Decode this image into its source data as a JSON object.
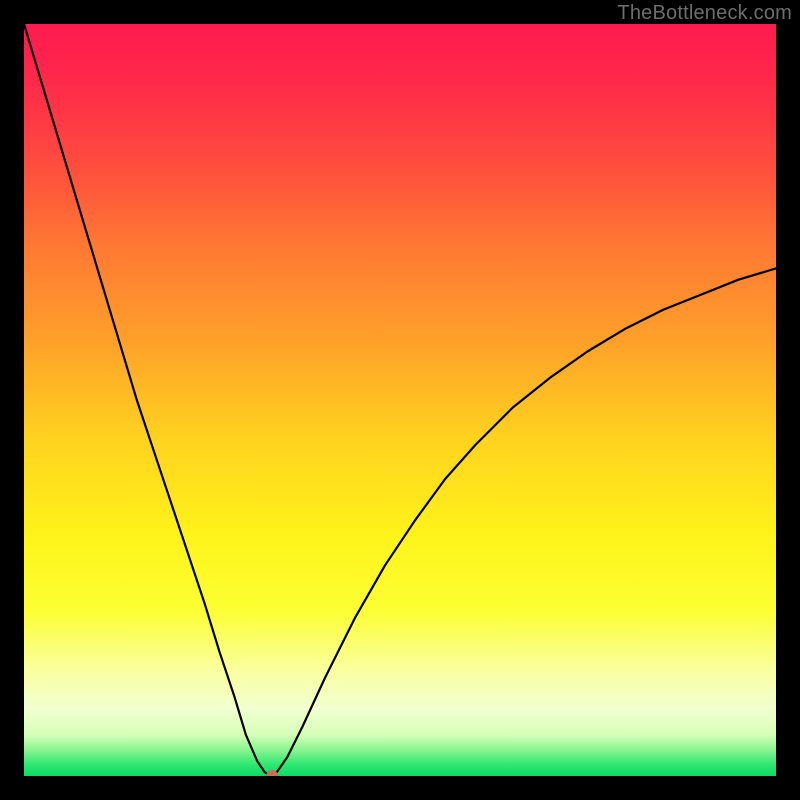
{
  "watermark": "TheBottleneck.com",
  "chart_data": {
    "type": "line",
    "title": "",
    "xlabel": "",
    "ylabel": "",
    "xlim": [
      0,
      100
    ],
    "ylim": [
      0,
      100
    ],
    "curve": {
      "name": "bottleneck-curve",
      "points": [
        {
          "x": 0.0,
          "y": 100.0
        },
        {
          "x": 3.0,
          "y": 90.0
        },
        {
          "x": 6.0,
          "y": 80.0
        },
        {
          "x": 9.0,
          "y": 70.0
        },
        {
          "x": 12.0,
          "y": 60.0
        },
        {
          "x": 15.0,
          "y": 50.0
        },
        {
          "x": 18.0,
          "y": 41.0
        },
        {
          "x": 21.0,
          "y": 32.0
        },
        {
          "x": 24.0,
          "y": 23.0
        },
        {
          "x": 26.0,
          "y": 16.5
        },
        {
          "x": 28.0,
          "y": 10.5
        },
        {
          "x": 29.5,
          "y": 5.5
        },
        {
          "x": 31.0,
          "y": 2.0
        },
        {
          "x": 32.0,
          "y": 0.5
        },
        {
          "x": 32.8,
          "y": 0.0
        },
        {
          "x": 33.6,
          "y": 0.5
        },
        {
          "x": 35.0,
          "y": 2.5
        },
        {
          "x": 37.0,
          "y": 6.5
        },
        {
          "x": 40.0,
          "y": 13.0
        },
        {
          "x": 44.0,
          "y": 21.0
        },
        {
          "x": 48.0,
          "y": 28.0
        },
        {
          "x": 52.0,
          "y": 34.0
        },
        {
          "x": 56.0,
          "y": 39.5
        },
        {
          "x": 60.0,
          "y": 44.0
        },
        {
          "x": 65.0,
          "y": 49.0
        },
        {
          "x": 70.0,
          "y": 53.0
        },
        {
          "x": 75.0,
          "y": 56.5
        },
        {
          "x": 80.0,
          "y": 59.5
        },
        {
          "x": 85.0,
          "y": 62.0
        },
        {
          "x": 90.0,
          "y": 64.0
        },
        {
          "x": 95.0,
          "y": 66.0
        },
        {
          "x": 100.0,
          "y": 67.5
        }
      ]
    },
    "optimal_point": {
      "x": 33.0,
      "y": 0.0
    },
    "gradient_stops": [
      {
        "offset": 0.0,
        "color": "#ff1a4f"
      },
      {
        "offset": 0.08,
        "color": "#ff2a4a"
      },
      {
        "offset": 0.18,
        "color": "#ff4a3f"
      },
      {
        "offset": 0.3,
        "color": "#ff7a33"
      },
      {
        "offset": 0.42,
        "color": "#ffa02a"
      },
      {
        "offset": 0.55,
        "color": "#ffd21f"
      },
      {
        "offset": 0.68,
        "color": "#fff31a"
      },
      {
        "offset": 0.78,
        "color": "#fcff33"
      },
      {
        "offset": 0.86,
        "color": "#faffa0"
      },
      {
        "offset": 0.91,
        "color": "#f2ffd0"
      },
      {
        "offset": 0.945,
        "color": "#d6ffb8"
      },
      {
        "offset": 0.965,
        "color": "#8af58f"
      },
      {
        "offset": 0.985,
        "color": "#2de872"
      },
      {
        "offset": 1.0,
        "color": "#0fd867"
      }
    ],
    "marker_color": "#c6705c"
  }
}
